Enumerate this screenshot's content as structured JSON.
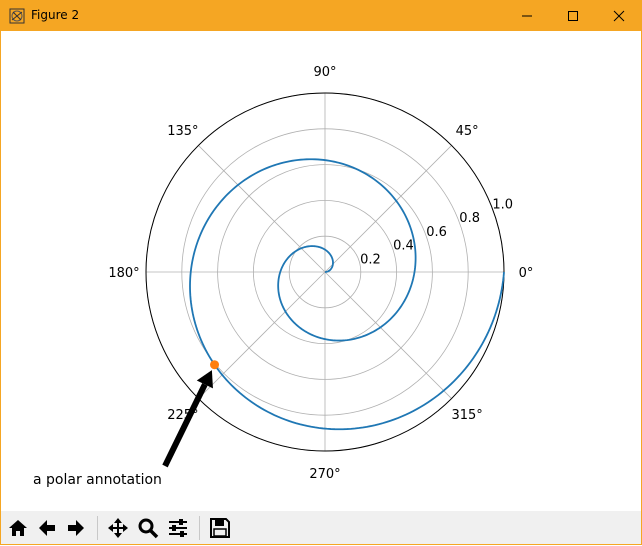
{
  "window": {
    "title": "Figure 2"
  },
  "colors": {
    "titlebar": "#f5a623",
    "series": "#1f77b4",
    "marker": "#ff7f0e",
    "grid": "#b0b0b0"
  },
  "chart_data": {
    "type": "line",
    "projection": "polar",
    "title": "",
    "theta_tick_labels": [
      "0°",
      "45°",
      "90°",
      "135°",
      "180°",
      "225°",
      "270°",
      "315°"
    ],
    "r_tick_labels": [
      "0.2",
      "0.4",
      "0.6",
      "0.8",
      "1.0"
    ],
    "r_ticks": [
      0.2,
      0.4,
      0.6,
      0.8,
      1.0
    ],
    "rlim": [
      0,
      1.0
    ],
    "grid": true,
    "series": [
      {
        "r_range": [
          0,
          1.0
        ],
        "theta_range_deg": [
          0,
          720
        ],
        "description_formula": "r = theta / (4*pi)"
      }
    ],
    "marker_point": {
      "theta_deg": 220,
      "r": 0.8056
    },
    "annotation": {
      "text": "a polar annotation",
      "target": {
        "theta_deg": 220,
        "r": 0.8056
      }
    }
  },
  "toolbar": {
    "buttons": [
      {
        "name": "home-button",
        "icon": "home-icon"
      },
      {
        "name": "back-button",
        "icon": "arrow-left-icon"
      },
      {
        "name": "forward-button",
        "icon": "arrow-right-icon"
      },
      {
        "name": "pan-button",
        "icon": "move-icon"
      },
      {
        "name": "zoom-button",
        "icon": "magnifier-icon"
      },
      {
        "name": "configure-subplots-button",
        "icon": "sliders-icon"
      },
      {
        "name": "save-button",
        "icon": "floppy-disk-icon"
      }
    ]
  }
}
